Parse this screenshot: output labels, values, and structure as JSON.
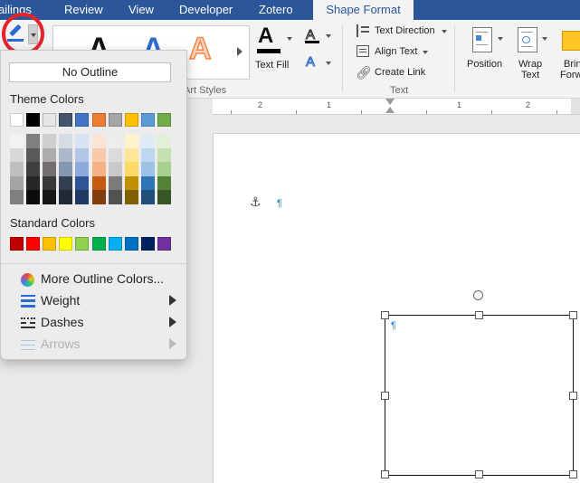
{
  "tabs": [
    {
      "label": "ailings"
    },
    {
      "label": "Review"
    },
    {
      "label": "View"
    },
    {
      "label": "Developer"
    },
    {
      "label": "Zotero"
    },
    {
      "label": "Shape Format",
      "active": true
    }
  ],
  "ribbon": {
    "wordart_group_label": "Art Styles",
    "text_fill_label": "Text Fill",
    "text_direction_label": "Text Direction",
    "align_text_label": "Align Text",
    "create_link_label": "Create Link",
    "text_group_label": "Text",
    "position_label": "Position",
    "wrap_text_label_1": "Wrap",
    "wrap_text_label_2": "Text",
    "bring_forward_label_1": "Brin",
    "bring_forward_label_2": "Forwa",
    "gallery_letters": [
      "A",
      "A",
      "A"
    ]
  },
  "ruler": {
    "labels": [
      "2",
      "1",
      "1",
      "2"
    ]
  },
  "document": {
    "pilcrow": "¶"
  },
  "outline_menu": {
    "no_outline": "No Outline",
    "theme_colors_heading": "Theme Colors",
    "standard_colors_heading": "Standard Colors",
    "theme_top_row": [
      "#ffffff",
      "#000000",
      "#e7e6e6",
      "#44546a",
      "#4472c4",
      "#ed7d31",
      "#a5a5a5",
      "#ffc000",
      "#5b9bd5",
      "#70ad47"
    ],
    "theme_shades": [
      [
        "#f2f2f2",
        "#7f7f7f",
        "#d0cece",
        "#d6dce4",
        "#d9e2f3",
        "#fbe4d5",
        "#ededed",
        "#fff2cc",
        "#deeaf6",
        "#e2efd9"
      ],
      [
        "#d8d8d8",
        "#595959",
        "#aeabab",
        "#adb9ca",
        "#b4c6e7",
        "#f7caac",
        "#dbdbdb",
        "#ffe599",
        "#bdd7ee",
        "#c5e0b3"
      ],
      [
        "#bfbfbf",
        "#3f3f3f",
        "#757070",
        "#8496b0",
        "#8eaadb",
        "#f4b183",
        "#c9c9c9",
        "#ffd966",
        "#9cc3e5",
        "#a8d08d"
      ],
      [
        "#a5a5a5",
        "#262626",
        "#3a3838",
        "#323f4f",
        "#2f5496",
        "#c55a11",
        "#7b7b7b",
        "#bf9000",
        "#2e75b5",
        "#538135"
      ],
      [
        "#7f7f7f",
        "#0c0c0c",
        "#171616",
        "#222a35",
        "#1f3864",
        "#833c0b",
        "#525252",
        "#7f6000",
        "#1f4e79",
        "#375623"
      ]
    ],
    "standard_colors": [
      "#c00000",
      "#ff0000",
      "#ffc000",
      "#ffff00",
      "#92d050",
      "#00b050",
      "#00b0f0",
      "#0070c0",
      "#002060",
      "#7030a0"
    ],
    "more_colors": "More Outline Colors...",
    "weight": "Weight",
    "dashes": "Dashes",
    "arrows": "Arrows"
  },
  "colors": {
    "tab_bar": "#2b579a",
    "highlight_circle": "#e5232b",
    "outline_pen": "#2b6cd4"
  }
}
